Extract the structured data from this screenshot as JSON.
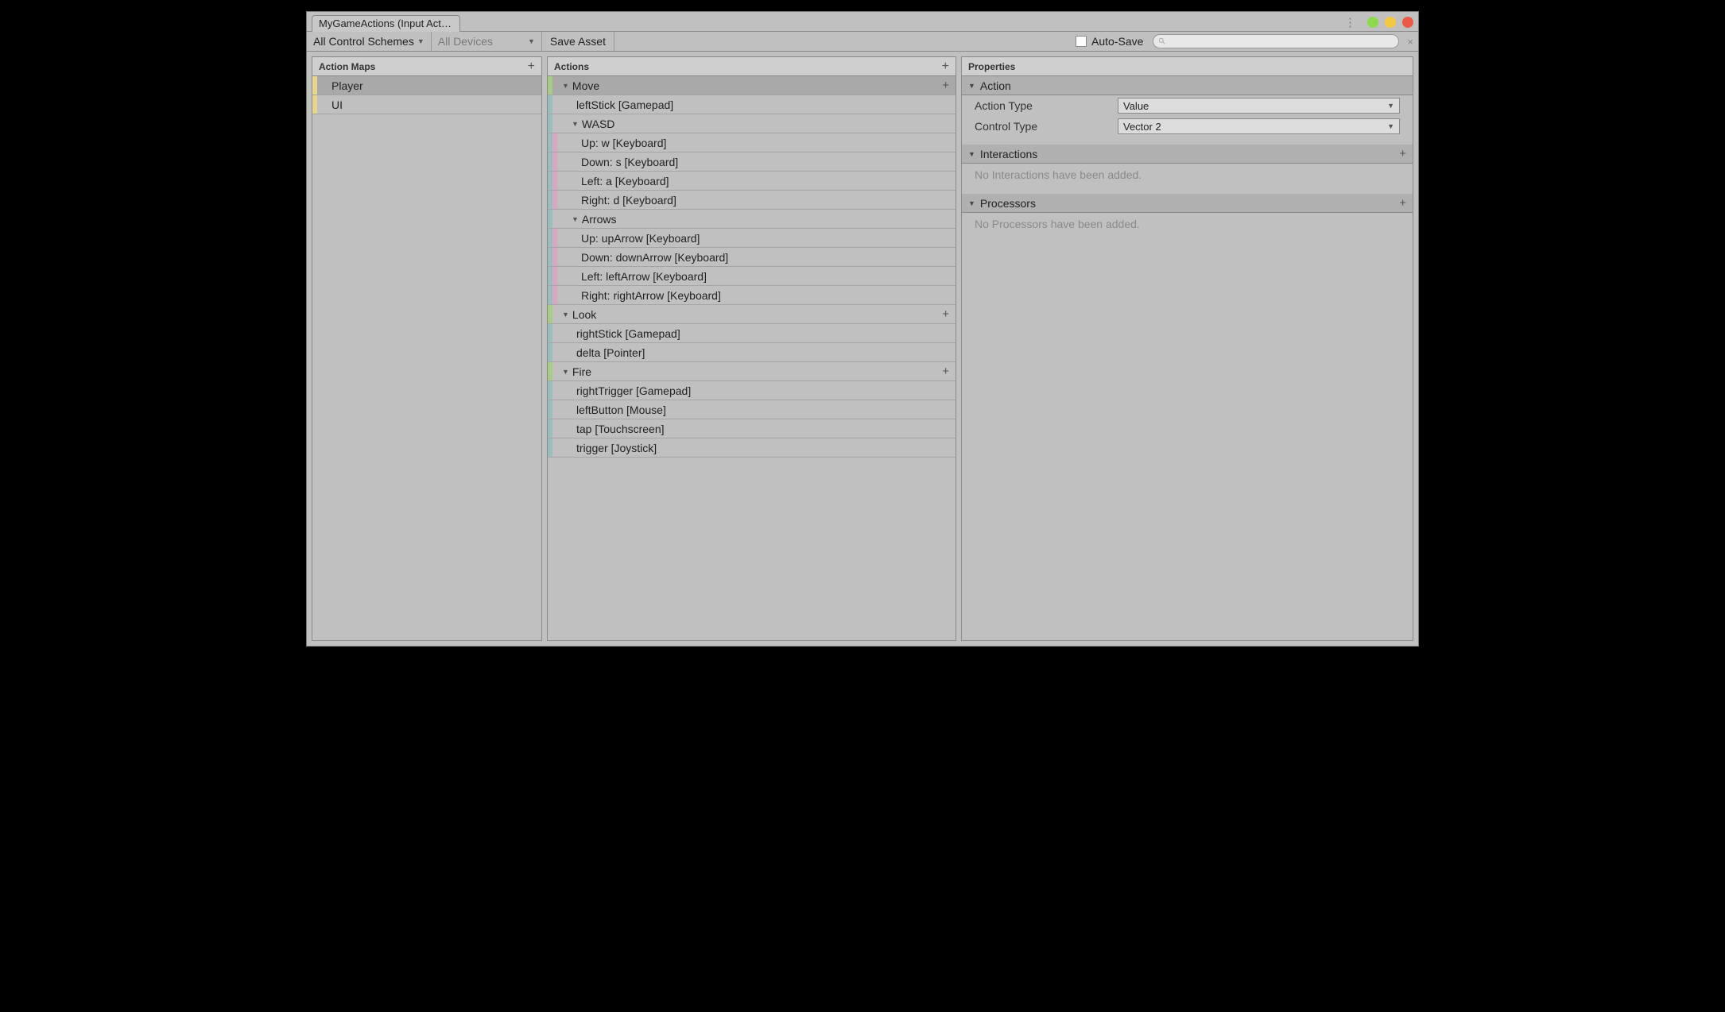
{
  "titlebar": {
    "tab": "MyGameActions (Input Act…"
  },
  "toolbar": {
    "schemes": "All Control Schemes",
    "devices": "All Devices",
    "save": "Save Asset",
    "auto_save": "Auto-Save"
  },
  "headers": {
    "maps": "Action Maps",
    "actions": "Actions",
    "props": "Properties"
  },
  "maps": [
    {
      "name": "Player",
      "selected": true
    },
    {
      "name": "UI",
      "selected": false
    }
  ],
  "actions": {
    "move": {
      "label": "Move",
      "leftstick": "leftStick [Gamepad]"
    },
    "wasd": {
      "label": "WASD",
      "up": "Up: w [Keyboard]",
      "down": "Down: s [Keyboard]",
      "left": "Left: a [Keyboard]",
      "right": "Right: d [Keyboard]"
    },
    "arrows": {
      "label": "Arrows",
      "up": "Up: upArrow [Keyboard]",
      "down": "Down: downArrow [Keyboard]",
      "left": "Left: leftArrow [Keyboard]",
      "right": "Right: rightArrow [Keyboard]"
    },
    "look": {
      "label": "Look",
      "rightstick": "rightStick [Gamepad]",
      "delta": "delta [Pointer]"
    },
    "fire": {
      "label": "Fire",
      "rt": "rightTrigger [Gamepad]",
      "lb": "leftButton [Mouse]",
      "tap": "tap [Touchscreen]",
      "trigger": "trigger [Joystick]"
    }
  },
  "props": {
    "action": "Action",
    "action_type_label": "Action Type",
    "action_type_value": "Value",
    "control_type_label": "Control Type",
    "control_type_value": "Vector 2",
    "interactions": "Interactions",
    "interactions_empty": "No Interactions have been added.",
    "processors": "Processors",
    "processors_empty": "No Processors have been added."
  }
}
